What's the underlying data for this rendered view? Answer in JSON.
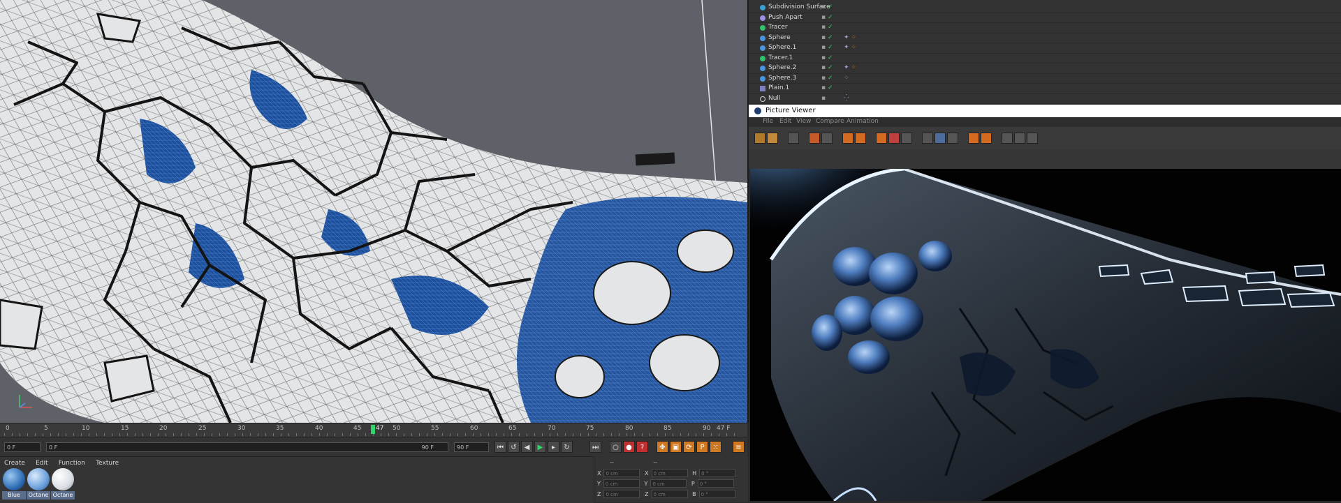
{
  "object_manager": {
    "rows": [
      {
        "name": "Subdivision Surface",
        "icon": "subdivision-icon",
        "color": "#3aa0d8"
      },
      {
        "name": "Push Apart",
        "icon": "push-apart-icon",
        "color": "#9a8fe0"
      },
      {
        "name": "Tracer",
        "icon": "tracer-icon",
        "color": "#2fc26b"
      },
      {
        "name": "Sphere",
        "icon": "sphere-icon",
        "color": "#4b95e0"
      },
      {
        "name": "Sphere.1",
        "icon": "sphere-icon",
        "color": "#4b95e0"
      },
      {
        "name": "Tracer.1",
        "icon": "tracer-icon",
        "color": "#2fc26b"
      },
      {
        "name": "Sphere.2",
        "icon": "sphere-icon",
        "color": "#4b95e0"
      },
      {
        "name": "Sphere.3",
        "icon": "sphere-icon",
        "color": "#4b95e0"
      },
      {
        "name": "Plain.1",
        "icon": "plain-icon",
        "color": "#7f7fbf"
      },
      {
        "name": "Null",
        "icon": "null-icon",
        "color": "#cfcfcf"
      }
    ]
  },
  "timeline": {
    "ticks": [
      "0",
      "5",
      "10",
      "15",
      "20",
      "25",
      "30",
      "35",
      "40",
      "45",
      "50",
      "55",
      "60",
      "65",
      "70",
      "75",
      "80",
      "85",
      "90"
    ],
    "current_frame": "47",
    "end_label": "47 F",
    "accent": "#2fd46b"
  },
  "transport": {
    "start_field": "0 F",
    "range_start": "0 F",
    "range_end": "90 F",
    "end_field": "90 F"
  },
  "material_manager": {
    "menu": [
      "Create",
      "Edit",
      "Function",
      "Texture"
    ],
    "materials": [
      {
        "label": "Blue",
        "color": "#2f6fb5"
      },
      {
        "label": "Octane",
        "color": "#6aa0dd"
      },
      {
        "label": "Octane",
        "color": "#e9eef2"
      }
    ]
  },
  "coordinates": {
    "header": "--",
    "header2": "--",
    "rows": [
      {
        "a": "X",
        "av": "0 cm",
        "b": "X",
        "bv": "0 cm",
        "c": "H",
        "cv": "0 °"
      },
      {
        "a": "Y",
        "av": "0 cm",
        "b": "Y",
        "bv": "0 cm",
        "c": "P",
        "cv": "0 °"
      },
      {
        "a": "Z",
        "av": "0 cm",
        "b": "Z",
        "bv": "0 cm",
        "c": "B",
        "cv": "0 °"
      }
    ]
  },
  "picture_viewer": {
    "title": "Picture Viewer",
    "menu": [
      "File",
      "Edit",
      "View",
      "Compare",
      "Animation"
    ]
  },
  "colors": {
    "viewport_bg": "#5e6167",
    "shard": "#e6e7e8",
    "inner_blue": "#1d4f9a",
    "render_bg": "#020203",
    "rim_light": "#d8ecff"
  }
}
